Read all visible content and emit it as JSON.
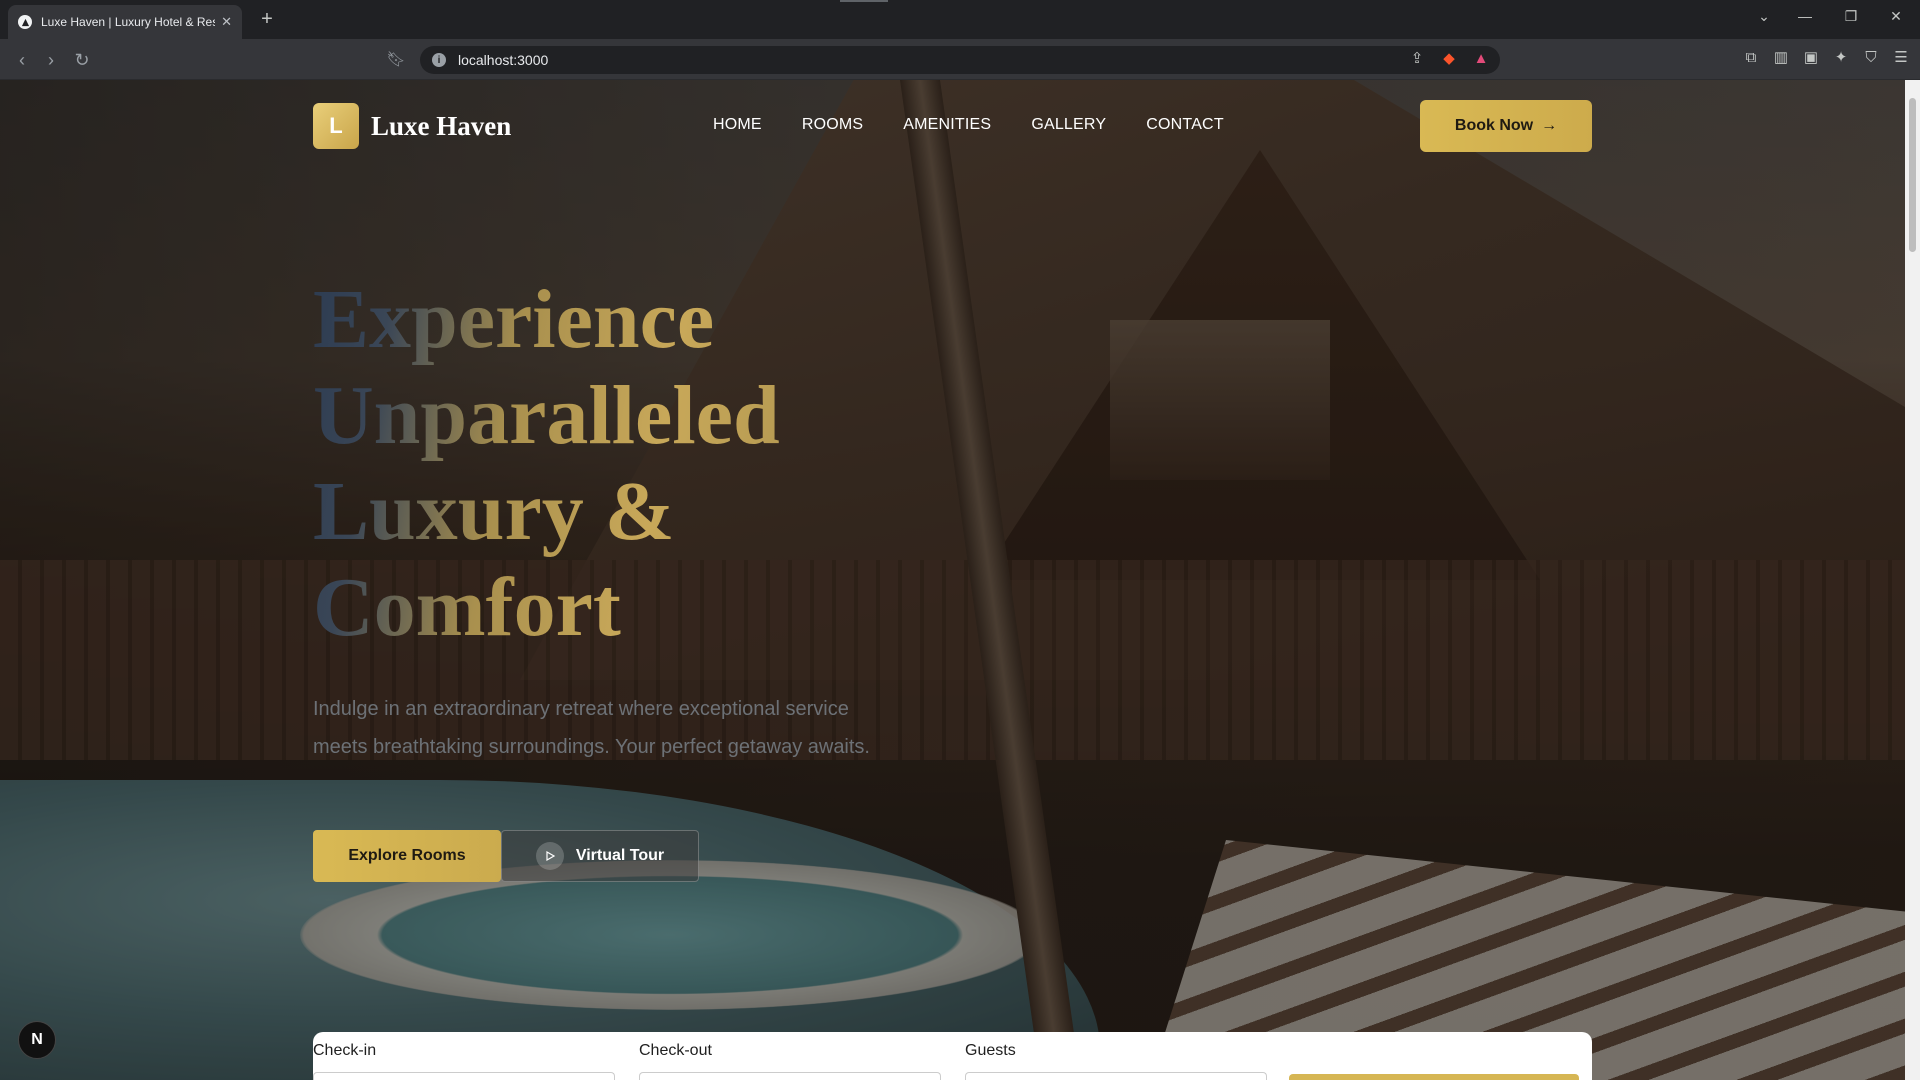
{
  "browser": {
    "tab_title": "Luxe Haven | Luxury Hotel & Resort",
    "url": "localhost:3000",
    "new_tab_symbol": "+",
    "close_symbol": "✕"
  },
  "site": {
    "logo_letter": "L",
    "logo_text": "Luxe Haven",
    "nav": [
      "HOME",
      "ROOMS",
      "AMENITIES",
      "GALLERY",
      "CONTACT"
    ],
    "book_now": "Book Now",
    "book_now_arrow": "→"
  },
  "hero": {
    "title_line1": "Experience",
    "title_line2": "Unparalleled",
    "title_line3": "Luxury &",
    "title_line4": "Comfort",
    "subtitle": "Indulge in an extraordinary retreat where exceptional service meets breathtaking surroundings. Your perfect getaway awaits.",
    "explore_button": "Explore Rooms",
    "tour_button": "Virtual Tour"
  },
  "booking": {
    "checkin_label": "Check-in",
    "checkout_label": "Check-out",
    "guests_label": "Guests"
  },
  "dev_badge": "N",
  "colors": {
    "accent_gold": "#d9b954",
    "chrome_dark": "#202124",
    "chrome_mid": "#35363a"
  }
}
